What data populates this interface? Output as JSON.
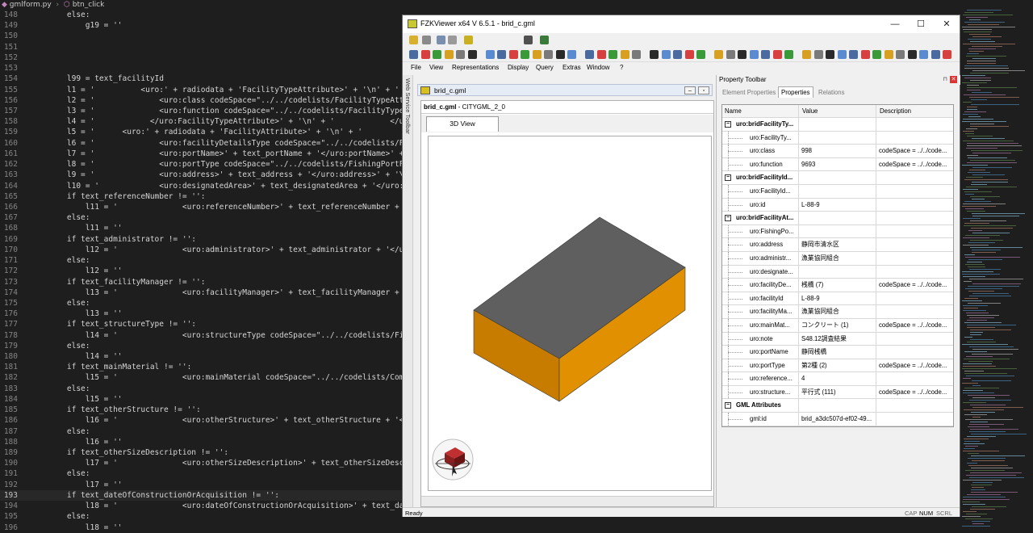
{
  "editor": {
    "breadcrumb": [
      "gmlform.py",
      "btn_click"
    ],
    "lines": [
      {
        "n": "148",
        "code": "    else:"
      },
      {
        "n": "149",
        "code": "        g19 = ''"
      },
      {
        "n": "150",
        "code": ""
      },
      {
        "n": "151",
        "code": ""
      },
      {
        "n": "152",
        "code": ""
      },
      {
        "n": "153",
        "code": ""
      },
      {
        "n": "154",
        "code": "    l99 = text_facilityId"
      },
      {
        "n": "155",
        "code": "    l1 = '          <uro:' + radiodata + 'FacilityTypeAttribute>' + '\\n' + '"
      },
      {
        "n": "156",
        "code": "    l2 = '              <uro:class codeSpace=\"../../codelists/FacilityTypeAttribu"
      },
      {
        "n": "157",
        "code": "    l3 = '              <uro:function codeSpace=\"../../codelists/FacilityTypeAttrib"
      },
      {
        "n": "158",
        "code": "    l4 = '            </uro:FacilityTypeAttribute>' + '\\n' + '            </uro:' +"
      },
      {
        "n": "159",
        "code": "    l5 = '      <uro:' + radiodata + 'FacilityAttribute>' + '\\n' + '           <uro:F"
      },
      {
        "n": "160",
        "code": "    l6 = '              <uro:facilityDetailsType codeSpace=\"../../codelists/FishingPor"
      },
      {
        "n": "161",
        "code": "    l7 = '              <uro:portName>' + text_portName + '</uro:portName>' + '\\n'"
      },
      {
        "n": "162",
        "code": "    l8 = '              <uro:portType codeSpace=\"../../codelists/FishingPortFacilityAt"
      },
      {
        "n": "163",
        "code": "    l9 = '              <uro:address>' + text_address + '</uro:address>' + '\\n'"
      },
      {
        "n": "164",
        "code": "    l10 = '             <uro:designatedArea>' + text_designatedArea + '</uro:designate"
      },
      {
        "n": "165",
        "code": "    if text_referenceNumber != '':"
      },
      {
        "n": "166",
        "code": "        l11 = '              <uro:referenceNumber>' + text_referenceNumber + '</uro:ref"
      },
      {
        "n": "167",
        "code": "    else:"
      },
      {
        "n": "168",
        "code": "        l11 = ''"
      },
      {
        "n": "169",
        "code": "    if text_administrator != '':"
      },
      {
        "n": "170",
        "code": "        l12 = '              <uro:administrator>' + text_administrator + '</uro:adminis"
      },
      {
        "n": "171",
        "code": "    else:"
      },
      {
        "n": "172",
        "code": "        l12 = ''"
      },
      {
        "n": "173",
        "code": "    if text_facilityManager != '':"
      },
      {
        "n": "174",
        "code": "        l13 = '              <uro:facilityManager>' + text_facilityManager + '</uro:fac"
      },
      {
        "n": "175",
        "code": "    else:"
      },
      {
        "n": "176",
        "code": "        l13 = ''"
      },
      {
        "n": "177",
        "code": "    if text_structureType != '':"
      },
      {
        "n": "178",
        "code": "        l14 = '              <uro:structureType codeSpace=\"../../codelists/FishingPortF"
      },
      {
        "n": "179",
        "code": "    else:"
      },
      {
        "n": "180",
        "code": "        l14 = ''"
      },
      {
        "n": "181",
        "code": "    if text_mainMaterial != '':"
      },
      {
        "n": "182",
        "code": "        l15 = '              <uro:mainMaterial codeSpace=\"../../codelists/Common_mainMa"
      },
      {
        "n": "183",
        "code": "    else:"
      },
      {
        "n": "184",
        "code": "        l15 = ''"
      },
      {
        "n": "185",
        "code": "    if text_otherStructure != '':"
      },
      {
        "n": "186",
        "code": "        l16 = '              <uro:otherStructure>' + text_otherStructure + '</uro:other"
      },
      {
        "n": "187",
        "code": "    else:"
      },
      {
        "n": "188",
        "code": "        l16 = ''"
      },
      {
        "n": "189",
        "code": "    if text_otherSizeDescription != '':"
      },
      {
        "n": "190",
        "code": "        l17 = '              <uro:otherSizeDescription>' + text_otherSizeDescription +"
      },
      {
        "n": "191",
        "code": "    else:"
      },
      {
        "n": "192",
        "code": "        l17 = ''"
      },
      {
        "n": "193",
        "code": "    if text_dateOfConstructionOrAcquisition != '':"
      },
      {
        "n": "194",
        "code": "        l18 = '              <uro:dateOfConstructionOrAcquisition>' + text_dateOfConstr"
      },
      {
        "n": "195",
        "code": "    else:"
      },
      {
        "n": "196",
        "code": "        l18 = ''"
      }
    ]
  },
  "viewer": {
    "title": "FZKViewer x64 V 6.5.1 - brid_c.gml",
    "window_buttons": [
      "—",
      "☐",
      "✕"
    ],
    "menu": [
      "File",
      "View",
      "Representations",
      "Display",
      "Query",
      "Extras",
      "Window",
      "?"
    ],
    "side_toolbar_label": "Web Service Toolbar",
    "doc_tab": "brid_c.gml",
    "doc_header_file": "brid_c.gml",
    "doc_header_schema": " - CITYGML_2_0",
    "view_tab": "3D View",
    "status_left": "Ready",
    "status_caps": "CAP",
    "status_num": "NUM",
    "status_scrl": "SCRL",
    "colors": {
      "box_top": "#5f5f5f",
      "box_front": "#c77c00",
      "box_side": "#e09000"
    }
  },
  "property_toolbar": {
    "title": "Property Toolbar",
    "tabs": [
      "Element Properties",
      "Properties",
      "Relations"
    ],
    "active_tab": "Properties",
    "columns": [
      "Name",
      "Value",
      "Description"
    ],
    "rows": [
      {
        "type": "group",
        "name": "uro:bridFacilityTy...",
        "value": "",
        "desc": ""
      },
      {
        "type": "item",
        "name": "uro:FacilityTy...",
        "value": "",
        "desc": ""
      },
      {
        "type": "item",
        "name": "uro:class",
        "value": "998",
        "desc": "codeSpace = ../../code..."
      },
      {
        "type": "item",
        "name": "uro:function",
        "value": "9693",
        "desc": "codeSpace = ../../code..."
      },
      {
        "type": "group",
        "name": "uro:bridFacilityId...",
        "value": "",
        "desc": ""
      },
      {
        "type": "item",
        "name": "uro:FacilityId...",
        "value": "",
        "desc": ""
      },
      {
        "type": "item",
        "name": "uro:id",
        "value": "L-88-9",
        "desc": ""
      },
      {
        "type": "group",
        "name": "uro:bridFacilityAt...",
        "value": "",
        "desc": ""
      },
      {
        "type": "item",
        "name": "uro:FishingPo...",
        "value": "",
        "desc": ""
      },
      {
        "type": "item",
        "name": "uro:address",
        "value": "静岡市清水区",
        "desc": ""
      },
      {
        "type": "item",
        "name": "uro:administr...",
        "value": "漁業協同組合",
        "desc": ""
      },
      {
        "type": "item",
        "name": "uro:designate...",
        "value": "",
        "desc": ""
      },
      {
        "type": "item",
        "name": "uro:facilityDe...",
        "value": "桟橋 (7)",
        "desc": "codeSpace = ../../code..."
      },
      {
        "type": "item",
        "name": "uro:facilityId",
        "value": "L-88-9",
        "desc": ""
      },
      {
        "type": "item",
        "name": "uro:facilityMa...",
        "value": "漁業協同組合",
        "desc": ""
      },
      {
        "type": "item",
        "name": "uro:mainMat...",
        "value": "コンクリート (1)",
        "desc": "codeSpace = ../../code..."
      },
      {
        "type": "item",
        "name": "uro:note",
        "value": "S48.12調査結果",
        "desc": ""
      },
      {
        "type": "item",
        "name": "uro:portName",
        "value": "静岡桟橋",
        "desc": ""
      },
      {
        "type": "item",
        "name": "uro:portType",
        "value": "第2種 (2)",
        "desc": "codeSpace = ../../code..."
      },
      {
        "type": "item",
        "name": "uro:reference...",
        "value": "4",
        "desc": ""
      },
      {
        "type": "item",
        "name": "uro:structure...",
        "value": "平行式 (111)",
        "desc": "codeSpace = ../../code..."
      },
      {
        "type": "group",
        "name": "GML Attributes",
        "value": "",
        "desc": ""
      },
      {
        "type": "item",
        "name": "gml:id",
        "value": "brid_a3dc507d-ef02-49...",
        "desc": ""
      }
    ]
  }
}
